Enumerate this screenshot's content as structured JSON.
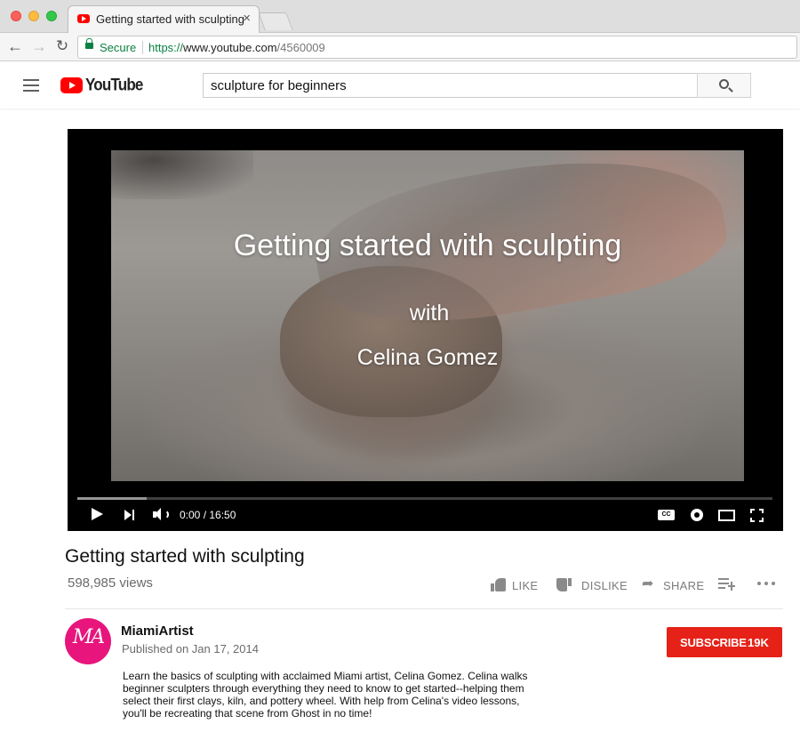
{
  "browser": {
    "tab_title": "Getting started with sculpting",
    "tab_close": "×",
    "secure_label": "Secure",
    "url_proto": "https://",
    "url_host": "www.youtube.com",
    "url_path": "/4560009"
  },
  "header": {
    "logo_text": "YouTube",
    "search_value": "sculpture for beginners",
    "brand_color": "#ff0000"
  },
  "player": {
    "overlay_title": "Getting started with sculpting",
    "overlay_with": "with",
    "overlay_name": "Celina Gomez",
    "time_readout": "0:00 / 16:50",
    "buffered_fraction": 0.1,
    "cc_label": "CC"
  },
  "video": {
    "title": "Getting started with sculpting",
    "views": "598,985 views",
    "like_label": "LIKE",
    "dislike_label": "DISLIKE",
    "share_label": "SHARE"
  },
  "channel": {
    "name": "MiamiArtist",
    "published": "Published on Jan 17, 2014",
    "avatar_text": "MA",
    "avatar_color": "#e7157c",
    "subscribe_label": "SUBSCRIBE",
    "subscriber_count": "19K",
    "subscribe_color": "#e62117"
  },
  "description": {
    "lines": [
      "Learn the basics of sculpting with acclaimed Miami artist, Celina Gomez.  Celina walks",
      "beginner sculpters through everything they need to know to get started--helping them",
      "select their first clays, kiln, and pottery wheel.  With help from Celina's video lessons,",
      "you'll be recreating that scene from Ghost in no time!"
    ]
  }
}
